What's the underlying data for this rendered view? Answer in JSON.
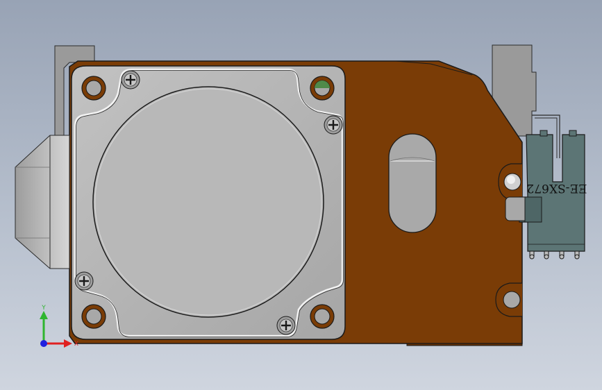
{
  "viewport": {
    "background_top": "#98a3b5",
    "background_bottom": "#cfd5df"
  },
  "model": {
    "bracket_color": "#7a3c06",
    "motor_face_color": "#b4b4b4",
    "sensor_color": "#5c7575",
    "sensor_label": "EE-SX672"
  },
  "triad": {
    "y_label": "Y",
    "x_label": "X",
    "y_color": "#2fb52f",
    "x_color": "#e02020",
    "z_color": "#2020e0"
  }
}
